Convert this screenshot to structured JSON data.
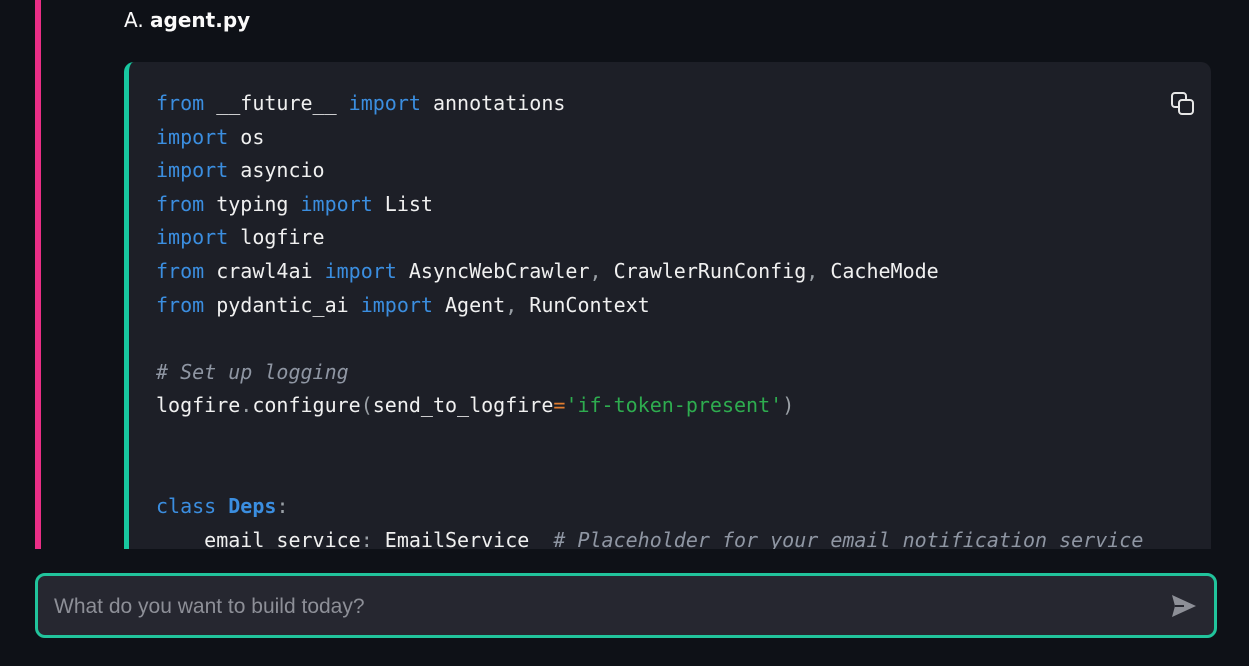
{
  "heading": {
    "prefix": "A. ",
    "filename": "agent.py"
  },
  "code": {
    "lines": [
      [
        {
          "t": "kw",
          "v": "from"
        },
        {
          "t": "",
          "v": " __future__ "
        },
        {
          "t": "kw",
          "v": "import"
        },
        {
          "t": "",
          "v": " annotations"
        }
      ],
      [
        {
          "t": "kw",
          "v": "import"
        },
        {
          "t": "",
          "v": " os"
        }
      ],
      [
        {
          "t": "kw",
          "v": "import"
        },
        {
          "t": "",
          "v": " asyncio"
        }
      ],
      [
        {
          "t": "kw",
          "v": "from"
        },
        {
          "t": "",
          "v": " typing "
        },
        {
          "t": "kw",
          "v": "import"
        },
        {
          "t": "",
          "v": " List"
        }
      ],
      [
        {
          "t": "kw",
          "v": "import"
        },
        {
          "t": "",
          "v": " logfire"
        }
      ],
      [
        {
          "t": "kw",
          "v": "from"
        },
        {
          "t": "",
          "v": " crawl4ai "
        },
        {
          "t": "kw",
          "v": "import"
        },
        {
          "t": "",
          "v": " AsyncWebCrawler"
        },
        {
          "t": "pn",
          "v": ","
        },
        {
          "t": "",
          "v": " CrawlerRunConfig"
        },
        {
          "t": "pn",
          "v": ","
        },
        {
          "t": "",
          "v": " CacheMode"
        }
      ],
      [
        {
          "t": "kw",
          "v": "from"
        },
        {
          "t": "",
          "v": " pydantic_ai "
        },
        {
          "t": "kw",
          "v": "import"
        },
        {
          "t": "",
          "v": " Agent"
        },
        {
          "t": "pn",
          "v": ","
        },
        {
          "t": "",
          "v": " RunContext"
        }
      ],
      [],
      [
        {
          "t": "cm",
          "v": "# Set up logging"
        }
      ],
      [
        {
          "t": "",
          "v": "logfire"
        },
        {
          "t": "pn",
          "v": "."
        },
        {
          "t": "",
          "v": "configure"
        },
        {
          "t": "pn",
          "v": "("
        },
        {
          "t": "",
          "v": "send_to_logfire"
        },
        {
          "t": "op",
          "v": "="
        },
        {
          "t": "st",
          "v": "'if-token-present'"
        },
        {
          "t": "pn",
          "v": ")"
        }
      ],
      [],
      [],
      [
        {
          "t": "kw",
          "v": "class"
        },
        {
          "t": "",
          "v": " "
        },
        {
          "t": "kwb",
          "v": "Deps"
        },
        {
          "t": "pn",
          "v": ":"
        }
      ],
      [
        {
          "t": "",
          "v": "    email_service"
        },
        {
          "t": "pn",
          "v": ":"
        },
        {
          "t": "",
          "v": " EmailService  "
        },
        {
          "t": "cm",
          "v": "# Placeholder for your email notification service"
        }
      ]
    ]
  },
  "icons": {
    "copy": "copy-icon",
    "send": "send-icon"
  },
  "chat": {
    "placeholder": "What do you want to build today?",
    "value": ""
  },
  "colors": {
    "accent_pink": "#ea2e86",
    "accent_green": "#21c49c",
    "keyword": "#3b8ee0",
    "string": "#2eac4f",
    "comment": "#8f96a3"
  }
}
